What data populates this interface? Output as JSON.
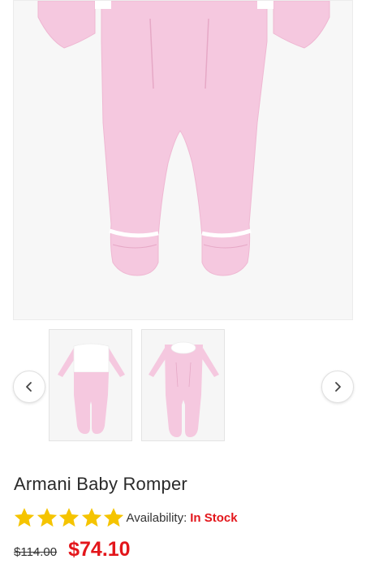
{
  "product": {
    "name": "Armani Baby Romper",
    "availability_label": "Availability:",
    "availability_value": "In Stock",
    "old_price": "$114.00",
    "new_price": "$74.10",
    "rating": 5,
    "rating_max": 5
  },
  "gallery": {
    "thumbnails": [
      "baby-romper-front-thumbnail",
      "baby-romper-collar-thumbnail"
    ],
    "prev_icon": "chevron-left-icon",
    "next_icon": "chevron-right-icon"
  },
  "colors": {
    "accent": "#e3161b",
    "star": "#f5c400",
    "garment_pink": "#f5c8df"
  }
}
